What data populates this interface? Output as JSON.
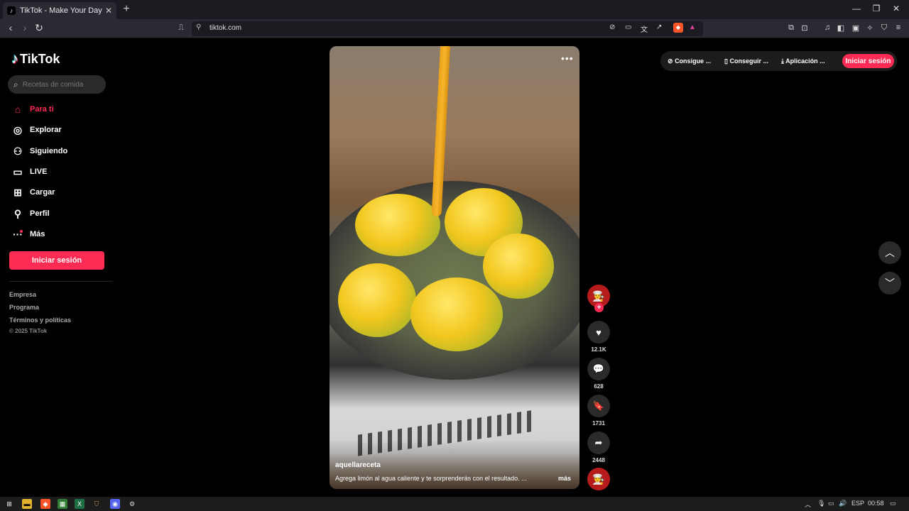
{
  "browser": {
    "tab_title": "TikTok - Make Your Day",
    "url": "tiktok.com"
  },
  "sidebar": {
    "brand": "TikTok",
    "search_placeholder": "Recetas de comida",
    "items": [
      {
        "label": "Para ti",
        "icon": "home-icon",
        "active": true
      },
      {
        "label": "Explorar",
        "icon": "compass-icon"
      },
      {
        "label": "Siguiendo",
        "icon": "following-icon"
      },
      {
        "label": "LIVE",
        "icon": "live-icon"
      },
      {
        "label": "Cargar",
        "icon": "upload-icon"
      },
      {
        "label": "Perfil",
        "icon": "profile-icon"
      },
      {
        "label": "Más",
        "icon": "more-dots-icon"
      }
    ],
    "login_label": "Iniciar sesión",
    "footer_links": [
      "Empresa",
      "Programa",
      "Términos y políticas"
    ],
    "copyright": "© 2025 TikTok"
  },
  "video": {
    "author": "aquellareceta",
    "caption": "Agrega limón al agua caliente y te sorprenderás con el resultado. ...",
    "more_label": "más"
  },
  "actions": {
    "likes": "12.1K",
    "comments": "628",
    "saves": "1731",
    "shares": "2448"
  },
  "topbar": {
    "btn1": "Consigue ...",
    "btn2": "Conseguir ...",
    "btn3": "Aplicación ...",
    "login": "Iniciar sesión"
  },
  "taskbar": {
    "lang": "ESP",
    "time": "00:58"
  },
  "colors": {
    "accent": "#fe2c55",
    "background": "#000000"
  }
}
